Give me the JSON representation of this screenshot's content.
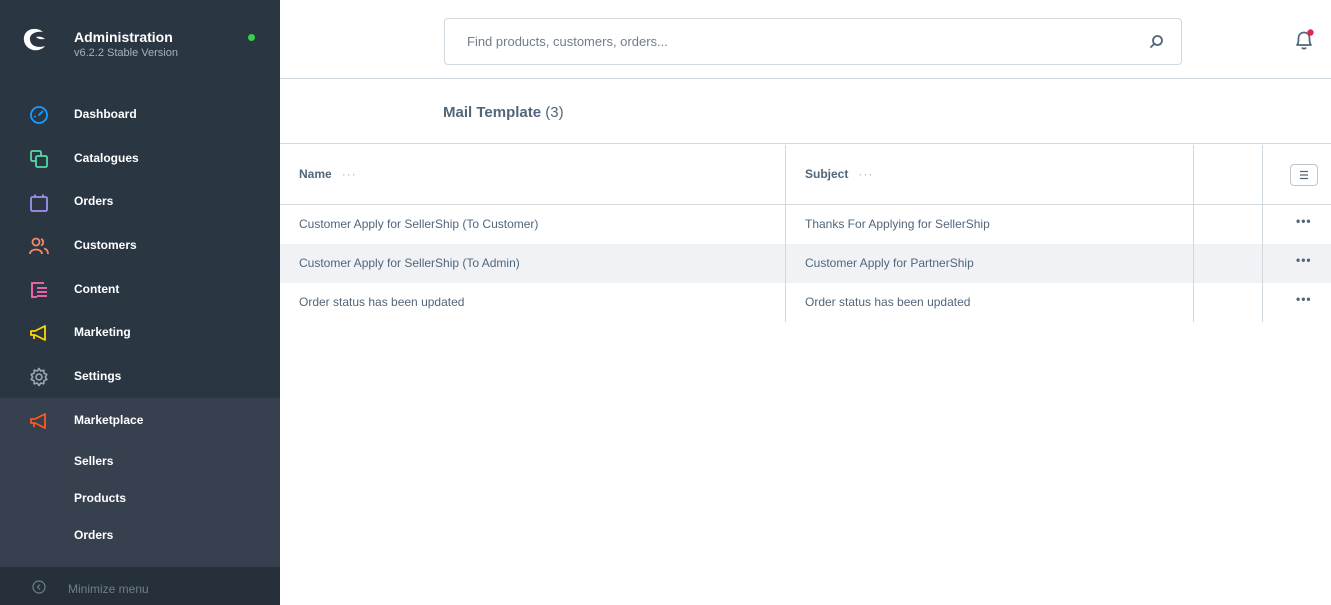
{
  "brand": {
    "title": "Administration",
    "version": "v6.2.2 Stable Version"
  },
  "nav": [
    {
      "label": "Dashboard",
      "icon": "dashboard-icon",
      "color": "#189eff"
    },
    {
      "label": "Catalogues",
      "icon": "catalogues-icon",
      "color": "#57d9a3"
    },
    {
      "label": "Orders",
      "icon": "orders-icon",
      "color": "#a092f0"
    },
    {
      "label": "Customers",
      "icon": "customers-icon",
      "color": "#f88962"
    },
    {
      "label": "Content",
      "icon": "content-icon",
      "color": "#ff68b4"
    },
    {
      "label": "Marketing",
      "icon": "marketing-icon",
      "color": "#ffd700"
    },
    {
      "label": "Settings",
      "icon": "settings-icon",
      "color": "#9aa8b5"
    },
    {
      "label": "Marketplace",
      "icon": "marketplace-icon",
      "color": "#ff5722",
      "active": true
    }
  ],
  "submenu": [
    "Sellers",
    "Products",
    "Orders"
  ],
  "minimize_label": "Minimize menu",
  "search": {
    "placeholder": "Find products, customers, orders..."
  },
  "page": {
    "title": "Mail Template",
    "count": "(3)"
  },
  "grid": {
    "columns": [
      "Name",
      "Subject"
    ],
    "column_menu_glyph": "···",
    "row_action_glyph": "•••",
    "rows": [
      {
        "name": "Customer Apply for SellerShip (To Customer)",
        "subject": "Thanks For Applying for SellerShip"
      },
      {
        "name": "Customer Apply for SellerShip (To Admin)",
        "subject": "Customer Apply for PartnerShip"
      },
      {
        "name": "Order status has been updated",
        "subject": "Order status has been updated"
      }
    ]
  }
}
